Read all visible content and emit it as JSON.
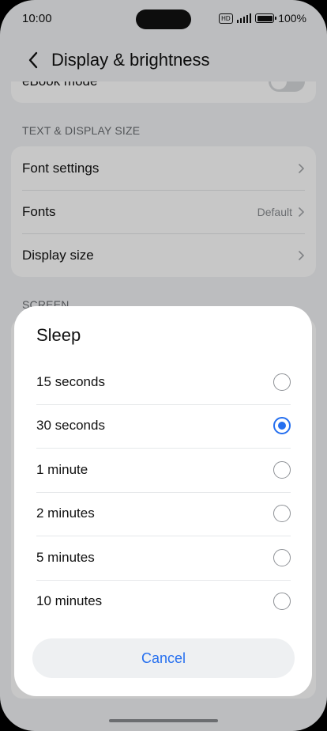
{
  "status_bar": {
    "time": "10:00",
    "hd": "HD",
    "battery_text": "100%"
  },
  "header": {
    "title": "Display & brightness"
  },
  "settings": {
    "partial_item": "eBook mode",
    "text_section": "TEXT & DISPLAY SIZE",
    "text_items": [
      {
        "label": "Font settings",
        "value": ""
      },
      {
        "label": "Fonts",
        "value": "Default"
      },
      {
        "label": "Display size",
        "value": ""
      }
    ],
    "screen_section": "SCREEN"
  },
  "dialog": {
    "title": "Sleep",
    "options": [
      {
        "label": "15 seconds",
        "selected": false
      },
      {
        "label": "30 seconds",
        "selected": true
      },
      {
        "label": "1 minute",
        "selected": false
      },
      {
        "label": "2 minutes",
        "selected": false
      },
      {
        "label": "5 minutes",
        "selected": false
      },
      {
        "label": "10 minutes",
        "selected": false
      }
    ],
    "cancel_label": "Cancel"
  },
  "colors": {
    "accent": "#256fef",
    "background": "#f1f3f5",
    "card": "#ffffff"
  }
}
